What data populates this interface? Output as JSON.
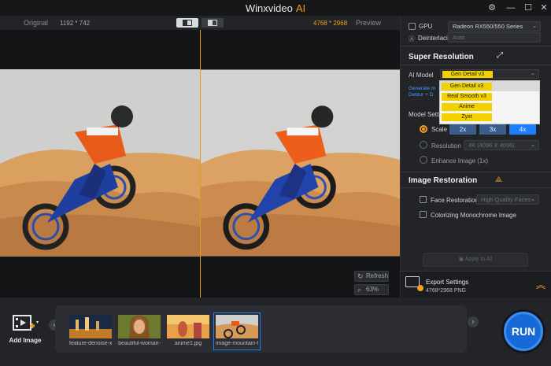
{
  "app": {
    "title": "Winxvideo",
    "title_accent": "AI",
    "accent_color": "#f0a01e"
  },
  "preview": {
    "original_label": "Original",
    "preview_label": "Preview",
    "original_resolution": "1192 * 742",
    "output_resolution": "4768 * 2968",
    "refresh_label": "Refresh",
    "zoom_label": "63%"
  },
  "panel": {
    "gpu_label": "GPU",
    "gpu_value": "Radeon RX550/550 Series",
    "deinterlacing_label": "Deinterlacing",
    "deinterlacing_value": "Auto",
    "super_resolution": {
      "title": "Super Resolution",
      "ai_model_label": "AI Model",
      "ai_model_value": "Gen Detail v3",
      "ai_model_options": [
        "Gen Detail v3",
        "Real Smooth v3",
        "Anime",
        "Zyxt"
      ],
      "generate_note_line1": "Generate m",
      "generate_note_line2": "Deblur + D",
      "model_settings_label": "Model Setti",
      "scale_label": "Scale",
      "scale_options": [
        "2x",
        "3x",
        "4x"
      ],
      "scale_selected": "4x",
      "resolution_label": "Resolution",
      "resolution_value": "4K (4096 X 4096)",
      "enhance_label": "Enhance Image (1x)"
    },
    "image_restoration": {
      "title": "Image Restoration",
      "face_restoration_label": "Face Restoration",
      "face_restoration_value": "High Quality Faces",
      "colorizing_label": "Colorizing Monochrome Image"
    },
    "apply_to_all_label": "Apply to All",
    "export": {
      "title": "Export Settings",
      "details": "4768*2968  PNG"
    }
  },
  "bottom": {
    "add_image_label": "Add Image",
    "thumbnails": [
      {
        "caption": "feature-denoise-x"
      },
      {
        "caption": "beautiful-woman-"
      },
      {
        "caption": "anime1.jpg"
      },
      {
        "caption": "image-mountain-l"
      }
    ],
    "run_label": "RUN"
  }
}
